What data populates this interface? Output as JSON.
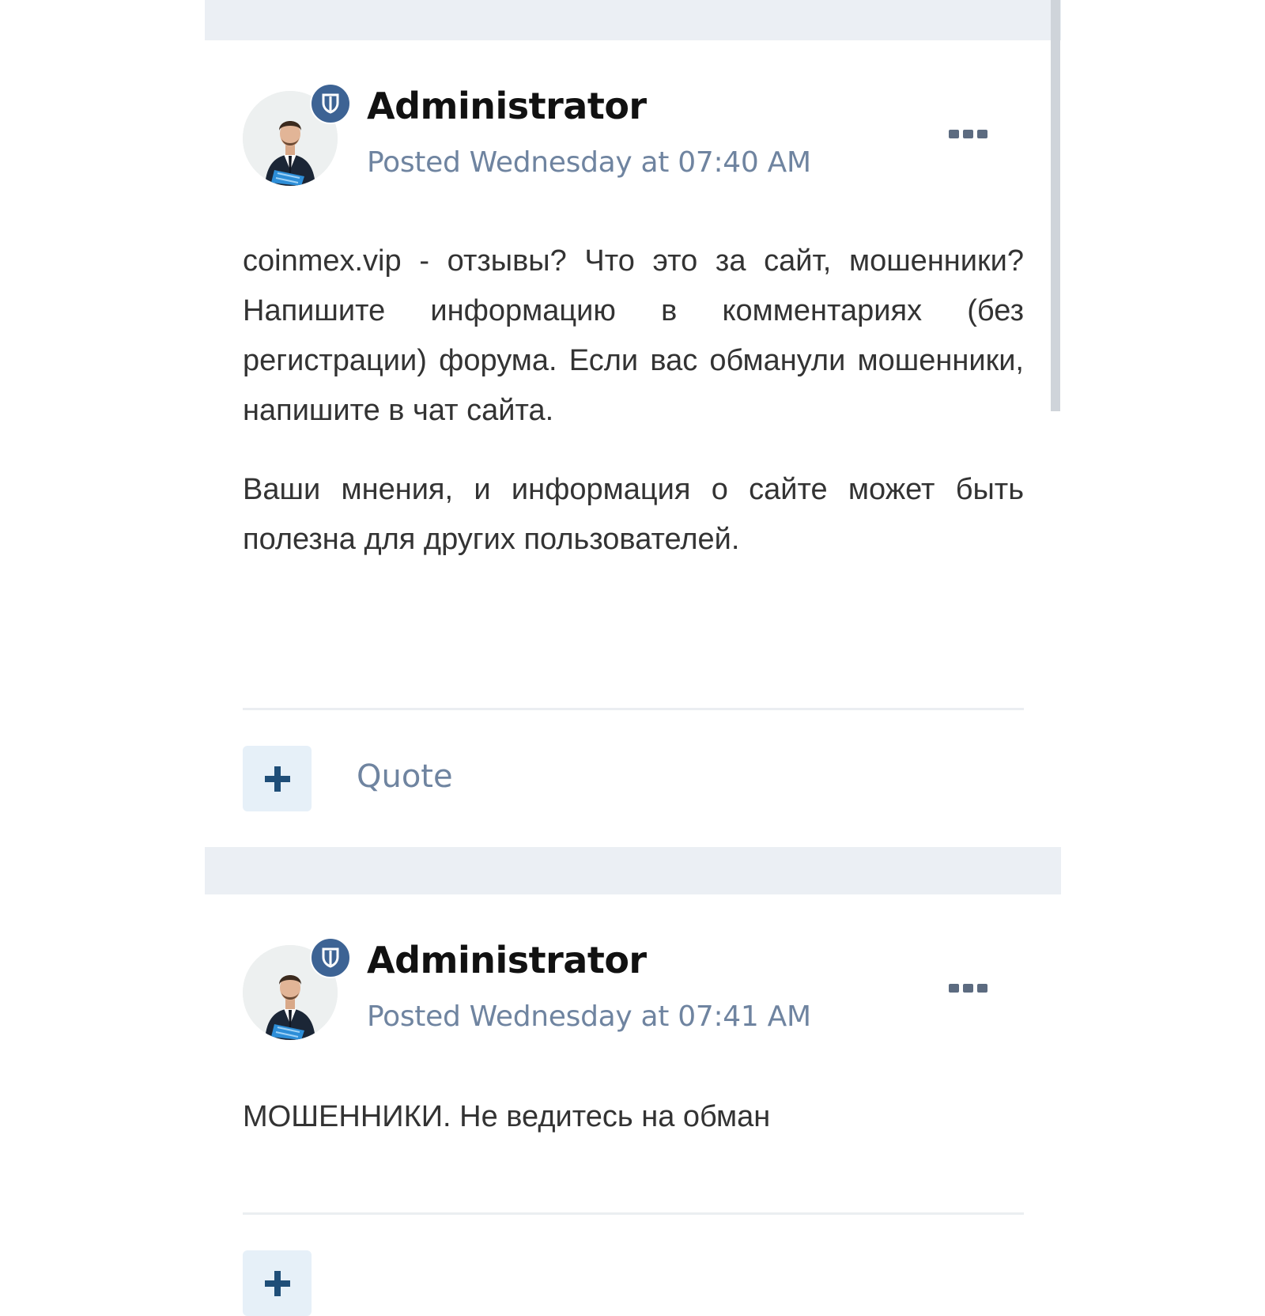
{
  "colors": {
    "band": "#ebeff4",
    "badge": "#3d6394",
    "meta_text": "#6f84a0",
    "body_text": "#333333",
    "author_text": "#111111",
    "button_bg": "#e6f0f8",
    "button_icon": "#1f4e78"
  },
  "icons": {
    "avatar": "businessman-avatar",
    "badge": "shield-icon",
    "menu": "more-options-icon",
    "reaction": "plus-icon"
  },
  "posts": [
    {
      "author": "Administrator",
      "posted": "Posted Wednesday at 07:40 AM",
      "paragraphs": [
        "coinmex.vip - отзывы? Что это за сайт, мошенники? Напишите информацию в комментариях (без регистрации) форума. Если вас обманули мошенники, напишите в чат сайта.",
        "Ваши мнения, и информация о сайте может быть полезна для других пользователей."
      ],
      "quote_label": "Quote"
    },
    {
      "author": "Administrator",
      "posted": "Posted Wednesday at 07:41 AM",
      "paragraphs": [
        "МОШЕННИКИ. Не ведитесь на обман"
      ]
    }
  ]
}
